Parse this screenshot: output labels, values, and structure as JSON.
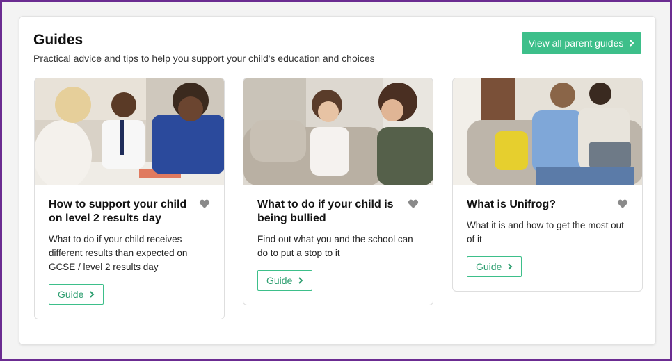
{
  "section": {
    "title": "Guides",
    "subtitle": "Practical advice and tips to help you support your child's education and choices",
    "view_all_label": "View all parent guides"
  },
  "colors": {
    "accent": "#3dbf8a",
    "frame": "#6b2c91",
    "heart": "#8a8a8a"
  },
  "cards": [
    {
      "title": "How to support your child on level 2 results day",
      "description": "What to do if your child receives different results than expected on GCSE / level 2 results day",
      "button_label": "Guide",
      "favourite_icon": "heart-icon"
    },
    {
      "title": "What to do if your child is being bullied",
      "description": "Find out what you and the school can do to put a stop to it",
      "button_label": "Guide",
      "favourite_icon": "heart-icon"
    },
    {
      "title": "What is Unifrog?",
      "description": "What it is and how to get the most out of it",
      "button_label": "Guide",
      "favourite_icon": "heart-icon"
    }
  ]
}
